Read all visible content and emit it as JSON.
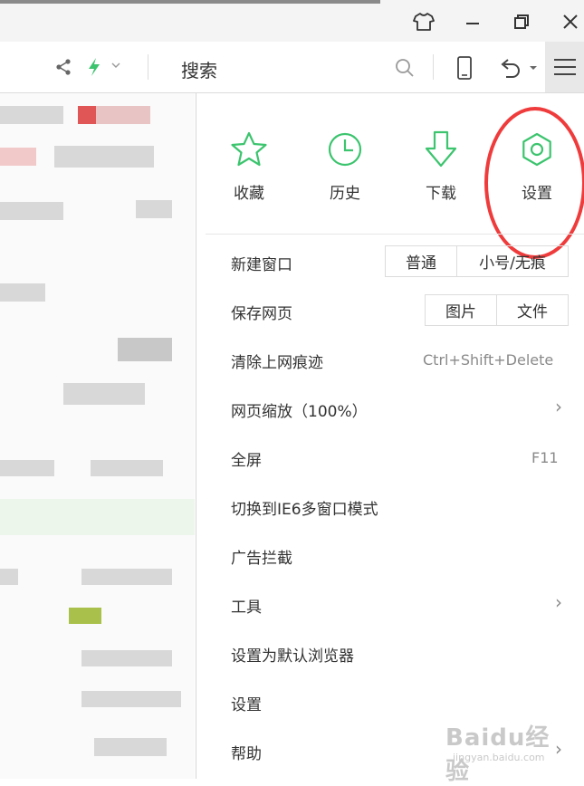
{
  "toolbar": {
    "search_text": "搜索"
  },
  "menu": {
    "quick_actions": [
      {
        "label": "收藏",
        "icon": "star-icon"
      },
      {
        "label": "历史",
        "icon": "clock-icon"
      },
      {
        "label": "下载",
        "icon": "download-arrow-icon"
      },
      {
        "label": "设置",
        "icon": "gear-icon"
      }
    ],
    "new_window": {
      "label": "新建窗口",
      "options": [
        "普通",
        "小号/无痕"
      ]
    },
    "save_page": {
      "label": "保存网页",
      "options": [
        "图片",
        "文件"
      ]
    },
    "clear_traces": {
      "label": "清除上网痕迹",
      "shortcut": "Ctrl+Shift+Delete"
    },
    "zoom": {
      "label": "网页缩放（100%）"
    },
    "fullscreen": {
      "label": "全屏",
      "shortcut": "F11"
    },
    "ie6_mode": {
      "label": "切换到IE6多窗口模式"
    },
    "ad_block": {
      "label": "广告拦截"
    },
    "tools": {
      "label": "工具"
    },
    "default_browser": {
      "label": "设置为默认浏览器"
    },
    "settings": {
      "label": "设置"
    },
    "help": {
      "label": "帮助"
    },
    "chevron": "›"
  },
  "watermark": {
    "main": "Baidu经验",
    "sub": "jingyan.baidu.com"
  },
  "colors": {
    "accent_green": "#3cc46e",
    "highlight_red": "#ef3b3b"
  }
}
